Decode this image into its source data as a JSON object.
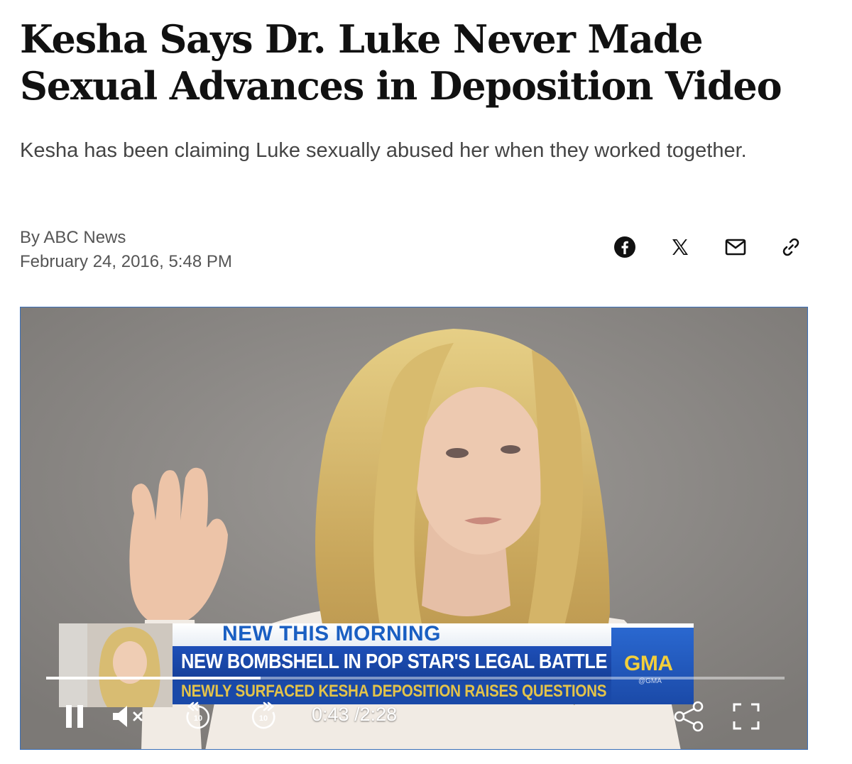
{
  "article": {
    "headline": "Kesha Says Dr. Luke Never Made Sexual Advances in Deposition Video",
    "dek": "Kesha has been claiming Luke sexually abused her when they worked together.",
    "byline": "By ABC News",
    "date": "February 24, 2016, 5:48 PM"
  },
  "share": {
    "icons": [
      "facebook-icon",
      "x-icon",
      "mail-icon",
      "link-icon"
    ]
  },
  "video": {
    "lower_third": {
      "top_line": "NEW THIS MORNING",
      "main_line": "NEW BOMBSHELL IN POP STAR'S LEGAL BATTLE",
      "sub_line": "NEWLY SURFACED KESHA DEPOSITION RAISES QUESTIONS",
      "network": "GMA",
      "handle": "@GMA"
    },
    "player": {
      "current_time": "0:43",
      "duration": "/2:28",
      "progress": 0.29,
      "skip_back": "10",
      "skip_forward": "10"
    },
    "colors": {
      "accent_blue": "#1a49a8",
      "accent_yellow": "#e3c34a"
    }
  }
}
